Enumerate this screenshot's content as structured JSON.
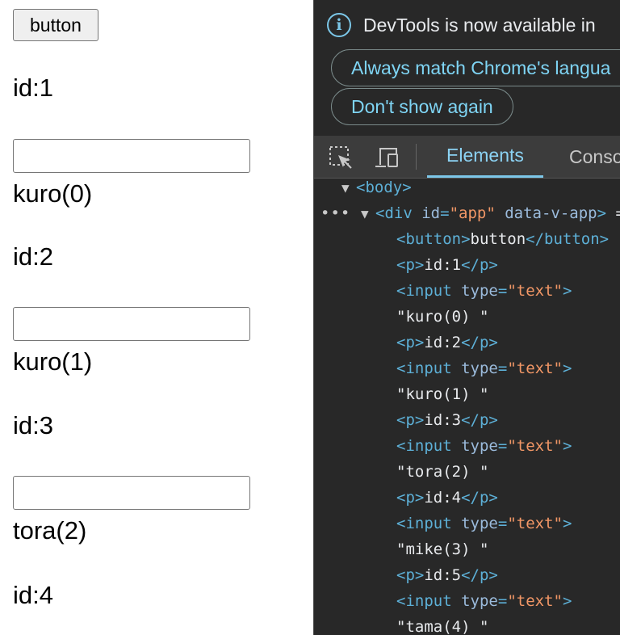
{
  "page": {
    "button_label": "button",
    "rows": [
      {
        "id_label": "id:1",
        "name_label": "kuro(0)"
      },
      {
        "id_label": "id:2",
        "name_label": "kuro(1)"
      },
      {
        "id_label": "id:3",
        "name_label": "tora(2)"
      },
      {
        "id_label": "id:4"
      }
    ]
  },
  "devtools": {
    "notice_text": "DevTools is now available in",
    "always_match_label": "Always match Chrome's langua",
    "dont_show_label": "Don't show again",
    "tabs": {
      "elements": "Elements",
      "console": "Conso"
    },
    "tree": {
      "body_tag": "<body>",
      "div_open": "<div",
      "div_id_attr": "id",
      "div_id_value": "\"app\"",
      "div_data_attr": "data-v-app",
      "div_close": ">",
      "div_trailer": "==",
      "button_open": "<button>",
      "button_text": "button",
      "button_close": "</button>",
      "p_open": "<p>",
      "p_close": "</p>",
      "input_open": "<input",
      "input_type_attr": "type",
      "input_type_value": "\"text\"",
      "input_close": ">",
      "p_texts": [
        "id:1",
        "id:2",
        "id:3",
        "id:4",
        "id:5"
      ],
      "text_nodes": [
        "\"kuro(0) \"",
        "\"kuro(1) \"",
        "\"tora(2) \"",
        "\"mike(3) \"",
        "\"tama(4) \""
      ]
    }
  }
}
